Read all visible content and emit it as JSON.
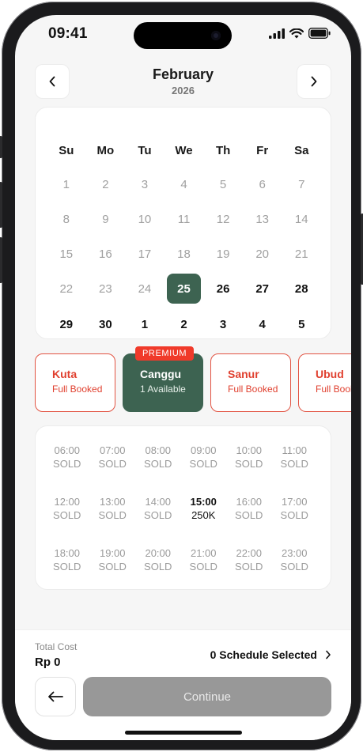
{
  "status_bar": {
    "time": "09:41"
  },
  "header": {
    "month": "February",
    "year": "2026"
  },
  "calendar": {
    "weekdays": [
      "Su",
      "Mo",
      "Tu",
      "We",
      "Th",
      "Fr",
      "Sa"
    ],
    "weeks": [
      [
        "1",
        "2",
        "3",
        "4",
        "5",
        "6",
        "7"
      ],
      [
        "8",
        "9",
        "10",
        "11",
        "12",
        "13",
        "14"
      ],
      [
        "15",
        "16",
        "17",
        "18",
        "19",
        "20",
        "21"
      ],
      [
        "22",
        "23",
        "24",
        "25",
        "26",
        "27",
        "28"
      ],
      [
        "29",
        "30",
        "1",
        "2",
        "3",
        "4",
        "5"
      ]
    ],
    "selected": "25"
  },
  "locations": [
    {
      "name": "Kuta",
      "status": "Full Booked",
      "badge": ""
    },
    {
      "name": "Canggu",
      "status": "1 Available",
      "badge": "PREMIUM"
    },
    {
      "name": "Sanur",
      "status": "Full Booked",
      "badge": ""
    },
    {
      "name": "Ubud",
      "status": "Full Booked",
      "badge": ""
    }
  ],
  "slots": [
    [
      {
        "time": "06:00",
        "status": "SOLD"
      },
      {
        "time": "07:00",
        "status": "SOLD"
      },
      {
        "time": "08:00",
        "status": "SOLD"
      },
      {
        "time": "09:00",
        "status": "SOLD"
      },
      {
        "time": "10:00",
        "status": "SOLD"
      },
      {
        "time": "11:00",
        "status": "SOLD"
      }
    ],
    [
      {
        "time": "12:00",
        "status": "SOLD"
      },
      {
        "time": "13:00",
        "status": "SOLD"
      },
      {
        "time": "14:00",
        "status": "SOLD"
      },
      {
        "time": "15:00",
        "status": "250K"
      },
      {
        "time": "16:00",
        "status": "SOLD"
      },
      {
        "time": "17:00",
        "status": "SOLD"
      }
    ],
    [
      {
        "time": "18:00",
        "status": "SOLD"
      },
      {
        "time": "19:00",
        "status": "SOLD"
      },
      {
        "time": "20:00",
        "status": "SOLD"
      },
      {
        "time": "21:00",
        "status": "SOLD"
      },
      {
        "time": "22:00",
        "status": "SOLD"
      },
      {
        "time": "23:00",
        "status": "SOLD"
      }
    ]
  ],
  "footer": {
    "total_label": "Total Cost",
    "total_value": "Rp 0",
    "schedule_text": "0 Schedule Selected",
    "continue_label": "Continue"
  },
  "colors": {
    "accent": "#3d6351",
    "danger": "#e0402f",
    "badge": "#f03a2a",
    "disabled": "#989898"
  },
  "icons": [
    "signal-icon",
    "wifi-icon",
    "battery-icon",
    "chevron-left-icon",
    "chevron-right-icon",
    "arrow-left-icon"
  ]
}
